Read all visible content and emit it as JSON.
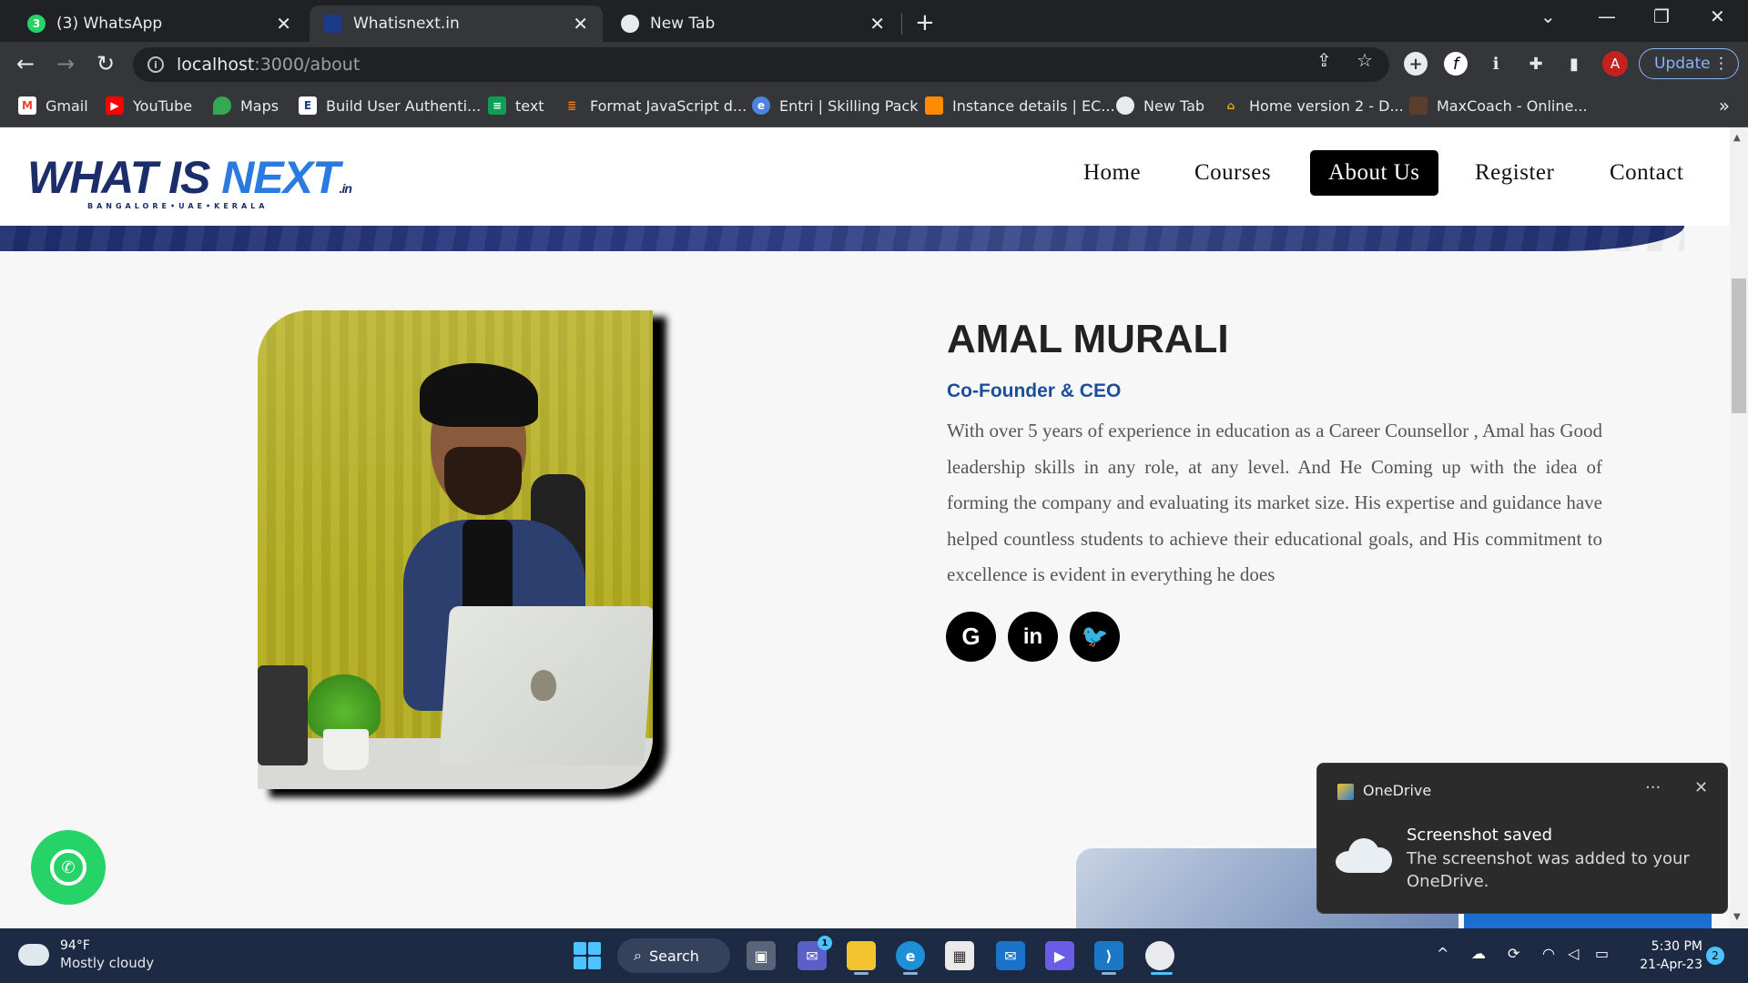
{
  "browser": {
    "tabs": [
      {
        "title": "(3) WhatsApp",
        "favicon_badge": "3"
      },
      {
        "title": "Whatisnext.in"
      },
      {
        "title": "New Tab"
      }
    ],
    "url": {
      "host": "localhost",
      "path": ":3000/about"
    },
    "update_label": "Update",
    "profile_initial": "A",
    "bookmarks": [
      {
        "label": "Gmail",
        "icon": "gmail-icon"
      },
      {
        "label": "YouTube",
        "icon": "youtube-icon"
      },
      {
        "label": "Maps",
        "icon": "maps-icon"
      },
      {
        "label": "Build User Authenti...",
        "icon": "page-icon"
      },
      {
        "label": "text",
        "icon": "doc-icon"
      },
      {
        "label": "Format JavaScript d...",
        "icon": "stack-icon"
      },
      {
        "label": "Entri | Skilling Pack",
        "icon": "entri-icon"
      },
      {
        "label": "Instance details | EC...",
        "icon": "aws-icon"
      },
      {
        "label": "New Tab",
        "icon": "chrome-icon"
      },
      {
        "label": "Home version 2 - D...",
        "icon": "mortarboard-icon"
      },
      {
        "label": "MaxCoach - Online...",
        "icon": "maxcoach-icon"
      }
    ]
  },
  "site": {
    "logo": {
      "main": "WHAT IS ",
      "accent": "NEXT",
      "tld": ".in",
      "tagline": "BANGALORE•UAE•KERALA"
    },
    "nav": [
      "Home",
      "Courses",
      "About Us",
      "Register",
      "Contact"
    ],
    "nav_active": "About Us"
  },
  "profile": {
    "name": "AMAL MURALI",
    "role": "Co-Founder & CEO",
    "bio": "With over 5 years of experience in education as a Career Counsellor , Amal has Good leadership skills in any role, at any level. And He Coming up with the idea of forming the company and evaluating its market size. His expertise and guidance have helped countless students to achieve their educational goals, and His commitment to excellence is evident in everything he does",
    "social": [
      {
        "name": "google",
        "glyph": "G"
      },
      {
        "name": "linkedin",
        "glyph": "in"
      },
      {
        "name": "twitter",
        "glyph": "🐦"
      }
    ]
  },
  "toast": {
    "app": "OneDrive",
    "title": "Screenshot saved",
    "body": "The screenshot was added to your OneDrive."
  },
  "taskbar": {
    "weather_temp": "94°F",
    "weather_cond": "Mostly cloudy",
    "search_label": "Search",
    "time": "5:30 PM",
    "date": "21-Apr-23",
    "notification_count": "2",
    "teams_badge": "1"
  }
}
